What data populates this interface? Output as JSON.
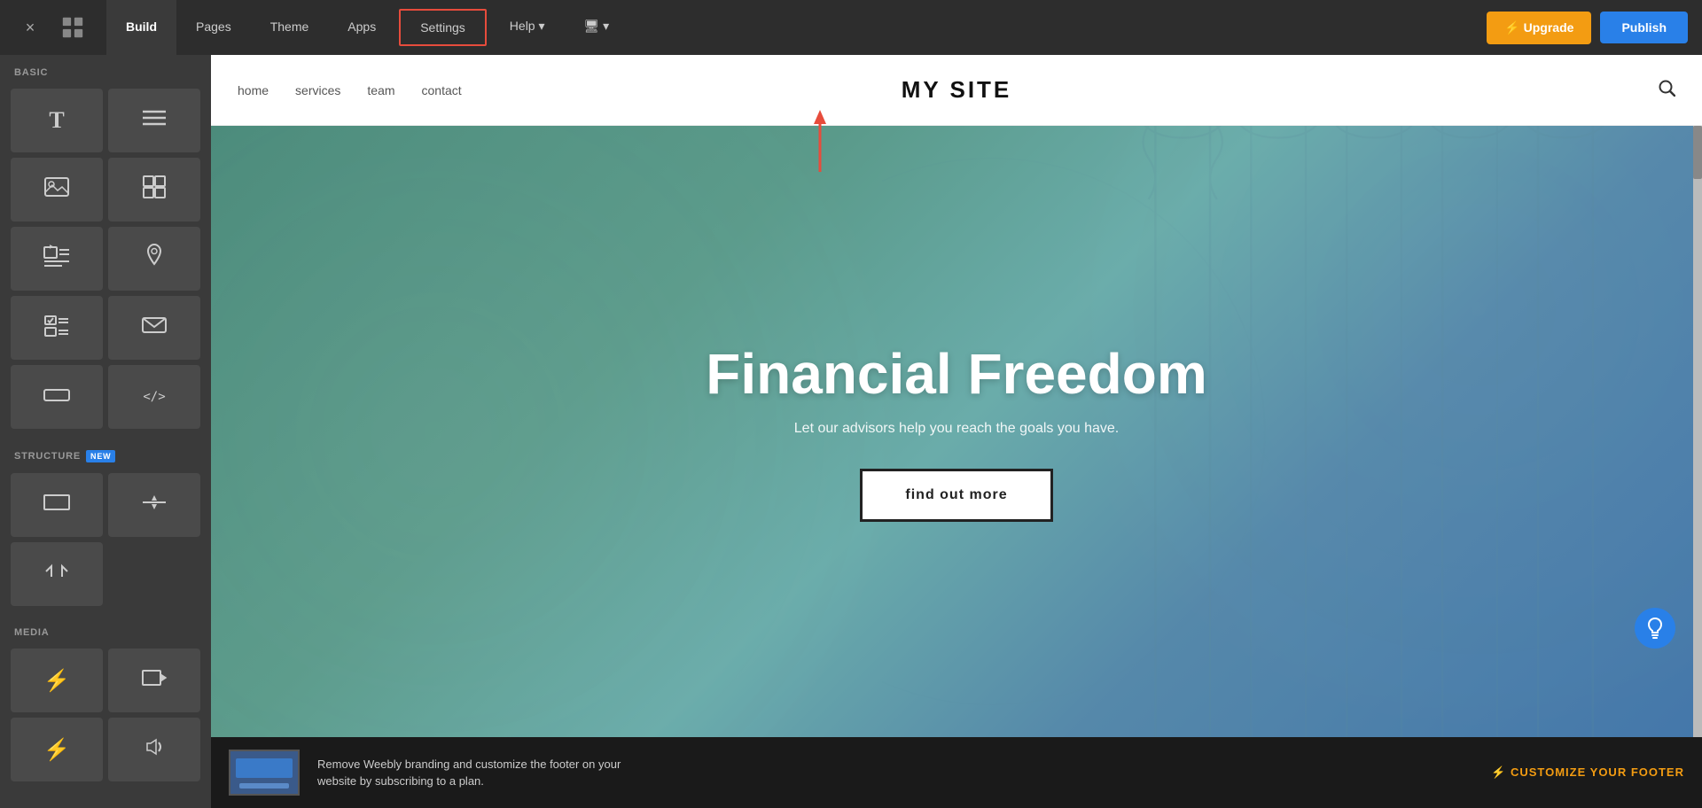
{
  "topNav": {
    "closeLabel": "×",
    "tabs": [
      {
        "id": "build",
        "label": "Build",
        "active": true
      },
      {
        "id": "pages",
        "label": "Pages",
        "active": false
      },
      {
        "id": "theme",
        "label": "Theme",
        "active": false
      },
      {
        "id": "apps",
        "label": "Apps",
        "active": false
      },
      {
        "id": "settings",
        "label": "Settings",
        "active": false,
        "highlighted": true
      },
      {
        "id": "help",
        "label": "Help ▾",
        "active": false
      },
      {
        "id": "device",
        "label": "🖥 ▾",
        "active": false
      }
    ],
    "upgradeLabel": "⚡ Upgrade",
    "publishLabel": "Publish"
  },
  "leftPanel": {
    "sections": [
      {
        "id": "basic",
        "label": "BASIC",
        "isNew": false,
        "items": [
          {
            "id": "text",
            "icon": "T"
          },
          {
            "id": "lines",
            "icon": "≡"
          },
          {
            "id": "image",
            "icon": "🖼"
          },
          {
            "id": "grid",
            "icon": "⊞"
          },
          {
            "id": "media-text",
            "icon": "📷"
          },
          {
            "id": "map",
            "icon": "📍"
          },
          {
            "id": "survey",
            "icon": "☑"
          },
          {
            "id": "email",
            "icon": "✉"
          },
          {
            "id": "button",
            "icon": "▬"
          },
          {
            "id": "code",
            "icon": "</>"
          }
        ]
      },
      {
        "id": "structure",
        "label": "STRUCTURE",
        "isNew": true,
        "items": [
          {
            "id": "section",
            "icon": "▭"
          },
          {
            "id": "divider",
            "icon": "÷"
          },
          {
            "id": "embed",
            "icon": "⟨⟩"
          }
        ]
      },
      {
        "id": "media",
        "label": "MEDIA",
        "isNew": false,
        "items": [
          {
            "id": "lightning-media",
            "icon": "⚡"
          },
          {
            "id": "video",
            "icon": "▶"
          },
          {
            "id": "lightning2",
            "icon": "⚡"
          },
          {
            "id": "audio",
            "icon": "🎵"
          }
        ]
      }
    ]
  },
  "siteNav": {
    "links": [
      {
        "id": "home",
        "label": "home"
      },
      {
        "id": "services",
        "label": "services"
      },
      {
        "id": "team",
        "label": "team"
      },
      {
        "id": "contact",
        "label": "contact"
      }
    ],
    "title": "MY SITE"
  },
  "hero": {
    "title": "Financial Freedom",
    "subtitle": "Let our advisors help you reach the goals you have.",
    "ctaLabel": "find out more"
  },
  "footer": {
    "text": "Remove Weebly branding and customize the footer on your website by subscribing to a plan.",
    "customizeLabel": "⚡  CUSTOMIZE YOUR FOOTER"
  },
  "colors": {
    "upgradeBtn": "#f39c12",
    "publishBtn": "#2980e8",
    "settingsBorder": "#e74c3c",
    "footerAccent": "#f39c12"
  }
}
